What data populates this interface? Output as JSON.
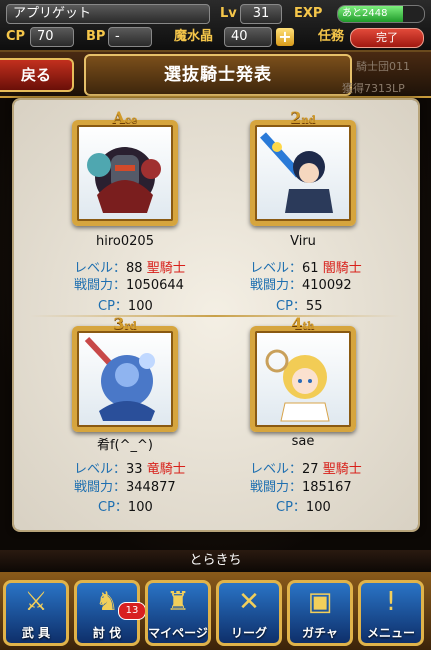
{
  "header": {
    "player_name": "アプリゲット",
    "lv_label": "Lv",
    "lv_value": "31",
    "exp_label": "EXP",
    "exp_text": "あと2448",
    "exp_fill": 0.75,
    "cp_label": "CP",
    "cp_value": "70",
    "bp_label": "BP",
    "bp_value": "-",
    "mana_label": "魔水晶",
    "mana_value": "40",
    "plus_label": "+",
    "mission_label": "任務",
    "mission_status": "完了"
  },
  "title": {
    "back_label": "戻る",
    "heading": "選抜騎士発表",
    "faint_right1": "騎士団011",
    "faint_right2": "獲得7313LP"
  },
  "knights": [
    {
      "rank_main": "A",
      "rank_suffix": "ce",
      "name": "hiro0205",
      "level_label": "レベル：",
      "level": "88",
      "class": "聖騎士",
      "power_label": "戦闘力：",
      "power": "1050644",
      "cp_label": "CP：",
      "cp": "100"
    },
    {
      "rank_main": "2",
      "rank_suffix": "nd",
      "name": "Viru",
      "level_label": "レベル：",
      "level": "61",
      "class": "闇騎士",
      "power_label": "戦闘力：",
      "power": "410092",
      "cp_label": "CP：",
      "cp": "55"
    },
    {
      "rank_main": "3",
      "rank_suffix": "rd",
      "name": "肴f(^_^)",
      "level_label": "レベル：",
      "level": "33",
      "class": "竜騎士",
      "power_label": "戦闘力：",
      "power": "344877",
      "cp_label": "CP：",
      "cp": "100"
    },
    {
      "rank_main": "4",
      "rank_suffix": "th",
      "name": "sae",
      "level_label": "レベル：",
      "level": "27",
      "class": "聖騎士",
      "power_label": "戦闘力：",
      "power": "185167",
      "cp_label": "CP：",
      "cp": "100"
    }
  ],
  "footer": {
    "ticker": "とらきち"
  },
  "nav": [
    {
      "label": "武 具",
      "icon": "weapon-icon"
    },
    {
      "label": "討 伐",
      "icon": "monster-icon",
      "badge": "13"
    },
    {
      "label": "マイページ",
      "icon": "knight-helmet-icon"
    },
    {
      "label": "リーグ",
      "icon": "crossed-swords-icon"
    },
    {
      "label": "ガチャ",
      "icon": "treasure-chest-icon"
    },
    {
      "label": "メニュー",
      "icon": "menu-icon"
    }
  ],
  "colors": {
    "accent_gold": "#d6a53e",
    "level_label_blue": "#1e6fb0",
    "class_red": "#d8201a"
  }
}
